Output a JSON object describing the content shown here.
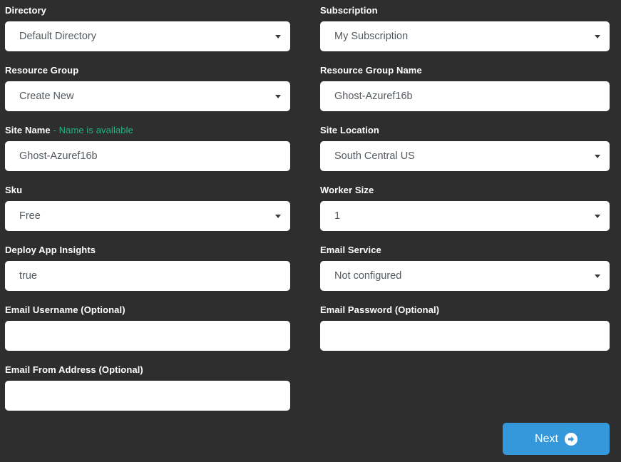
{
  "theme": {
    "background": "#2e2e2e",
    "label_color": "#ffffff",
    "input_background": "#ffffff",
    "input_text_color": "#555a60",
    "status_available_color": "#1fb57e",
    "accent_button_color": "#3498db"
  },
  "form": {
    "fields": [
      {
        "key": "directory",
        "label": "Directory",
        "type": "select",
        "value": "Default Directory",
        "column": "left"
      },
      {
        "key": "subscription",
        "label": "Subscription",
        "type": "select",
        "value": "My Subscription",
        "column": "right"
      },
      {
        "key": "resource_group",
        "label": "Resource Group",
        "type": "select",
        "value": "Create New",
        "column": "left"
      },
      {
        "key": "resource_group_name",
        "label": "Resource Group Name",
        "type": "text",
        "value": "Ghost-Azuref16b",
        "column": "right"
      },
      {
        "key": "site_name",
        "label": "Site Name",
        "status": "- Name is available",
        "type": "text",
        "value": "Ghost-Azuref16b",
        "column": "left"
      },
      {
        "key": "site_location",
        "label": "Site Location",
        "type": "select",
        "value": "South Central US",
        "column": "right"
      },
      {
        "key": "sku",
        "label": "Sku",
        "type": "select",
        "value": "Free",
        "column": "left"
      },
      {
        "key": "worker_size",
        "label": "Worker Size",
        "type": "select",
        "value": "1",
        "column": "right"
      },
      {
        "key": "deploy_app_insights",
        "label": "Deploy App Insights",
        "type": "text",
        "value": "true",
        "column": "left"
      },
      {
        "key": "email_service",
        "label": "Email Service",
        "type": "select",
        "value": "Not configured",
        "column": "right"
      },
      {
        "key": "email_username",
        "label": "Email Username (Optional)",
        "type": "text",
        "value": "",
        "placeholder": "",
        "column": "left"
      },
      {
        "key": "email_password",
        "label": "Email Password (Optional)",
        "type": "text",
        "value": "",
        "placeholder": "",
        "column": "right"
      },
      {
        "key": "email_from_address",
        "label": "Email From Address (Optional)",
        "type": "text",
        "value": "",
        "placeholder": "",
        "column": "left"
      }
    ]
  },
  "footer": {
    "next_label": "Next",
    "next_icon": "arrow-circle-right-icon"
  }
}
